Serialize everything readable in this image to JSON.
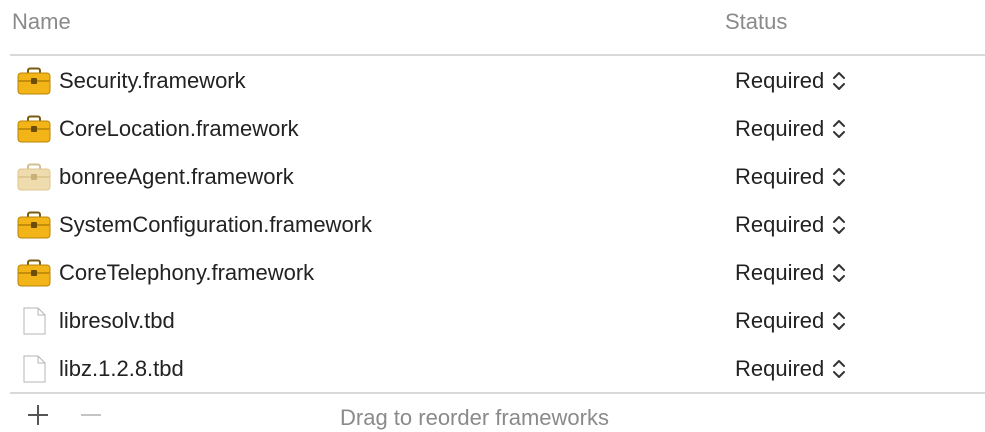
{
  "header": {
    "name_label": "Name",
    "status_label": "Status"
  },
  "rows": [
    {
      "name": "Security.framework",
      "status": "Required",
      "icon": "toolbox-icon"
    },
    {
      "name": "CoreLocation.framework",
      "status": "Required",
      "icon": "toolbox-icon"
    },
    {
      "name": "bonreeAgent.framework",
      "status": "Required",
      "icon": "toolbox-faded-icon"
    },
    {
      "name": "SystemConfiguration.framework",
      "status": "Required",
      "icon": "toolbox-icon"
    },
    {
      "name": "CoreTelephony.framework",
      "status": "Required",
      "icon": "toolbox-icon"
    },
    {
      "name": "libresolv.tbd",
      "status": "Required",
      "icon": "document-icon"
    },
    {
      "name": "libz.1.2.8.tbd",
      "status": "Required",
      "icon": "document-icon"
    }
  ],
  "footer": {
    "hint": "Drag to reorder frameworks",
    "add_icon": "plus-icon",
    "remove_icon": "minus-icon"
  },
  "colors": {
    "header_text": "#8a8a8a",
    "row_text": "#222222",
    "divider": "#d9d9d9",
    "toolbox_body": "#f2b417",
    "toolbox_faded": "#efdcae"
  }
}
